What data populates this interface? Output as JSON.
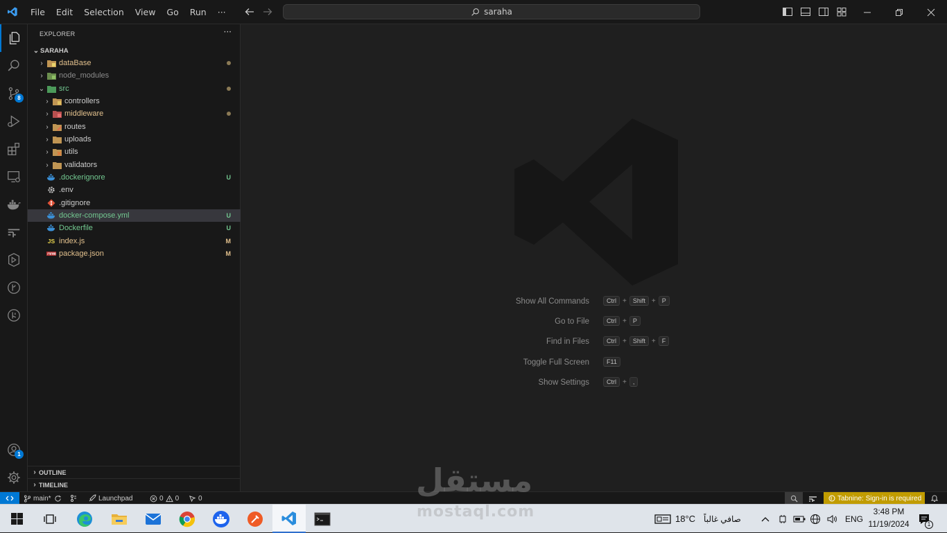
{
  "titlebar": {
    "menu": [
      "File",
      "Edit",
      "Selection",
      "View",
      "Go",
      "Run",
      "···"
    ],
    "search_text": "saraha"
  },
  "activity_bar": {
    "icons": [
      "files-icon",
      "search-icon",
      "source-control-icon",
      "run-debug-icon",
      "extensions-icon",
      "remote-explorer-icon",
      "docker-icon",
      "testing-icon",
      "gitlens-icon",
      "git-graph-icon",
      "tabnine-icon"
    ],
    "source_control_badge": "8",
    "accounts_badge": "1"
  },
  "explorer": {
    "title": "EXPLORER",
    "more": "···",
    "root": "SARAHA",
    "items": [
      {
        "label": "dataBase",
        "color": "#e2c08d",
        "status": "dot"
      },
      {
        "label": "node_modules",
        "color": "#8b8b8b",
        "status": ""
      },
      {
        "label": "src",
        "color": "#73c991",
        "status": "dot"
      },
      {
        "label": "controllers",
        "color": "#cccccc",
        "status": ""
      },
      {
        "label": "middleware",
        "color": "#e2c08d",
        "status": "dot"
      },
      {
        "label": "routes",
        "color": "#cccccc",
        "status": ""
      },
      {
        "label": "uploads",
        "color": "#cccccc",
        "status": ""
      },
      {
        "label": "utils",
        "color": "#cccccc",
        "status": ""
      },
      {
        "label": "validators",
        "color": "#cccccc",
        "status": ""
      },
      {
        "label": ".dockerignore",
        "color": "#73c991",
        "status": "U"
      },
      {
        "label": ".env",
        "color": "#cccccc",
        "status": ""
      },
      {
        "label": ".gitignore",
        "color": "#cccccc",
        "status": ""
      },
      {
        "label": "docker-compose.yml",
        "color": "#73c991",
        "status": "U"
      },
      {
        "label": "Dockerfile",
        "color": "#73c991",
        "status": "U"
      },
      {
        "label": "index.js",
        "color": "#e2c08d",
        "status": "M"
      },
      {
        "label": "package.json",
        "color": "#e2c08d",
        "status": "M"
      }
    ],
    "sections": [
      "OUTLINE",
      "TIMELINE"
    ]
  },
  "editor": {
    "hints": [
      {
        "label": "Show All Commands",
        "keys": [
          "Ctrl",
          "Shift",
          "P"
        ]
      },
      {
        "label": "Go to File",
        "keys": [
          "Ctrl",
          "P"
        ]
      },
      {
        "label": "Find in Files",
        "keys": [
          "Ctrl",
          "Shift",
          "F"
        ]
      },
      {
        "label": "Toggle Full Screen",
        "keys": [
          "F11"
        ]
      },
      {
        "label": "Show Settings",
        "keys": [
          "Ctrl",
          ","
        ]
      }
    ]
  },
  "statusbar": {
    "branch": "main*",
    "launchpad": "Launchpad",
    "errors": "0",
    "warnings": "0",
    "ports": "0",
    "tabnine": "Tabnine: Sign-in is required",
    "accent": "#0078d4",
    "tabnine_bg": "#c19c00"
  },
  "taskbar": {
    "weather_temp": "18°C",
    "weather_desc": "صافي غالباً",
    "language": "ENG",
    "time": "3:48 PM",
    "date": "11/19/2024",
    "notification_count": "1"
  },
  "watermark": {
    "arabic": "مستقل",
    "latin": "mostaql.com"
  }
}
